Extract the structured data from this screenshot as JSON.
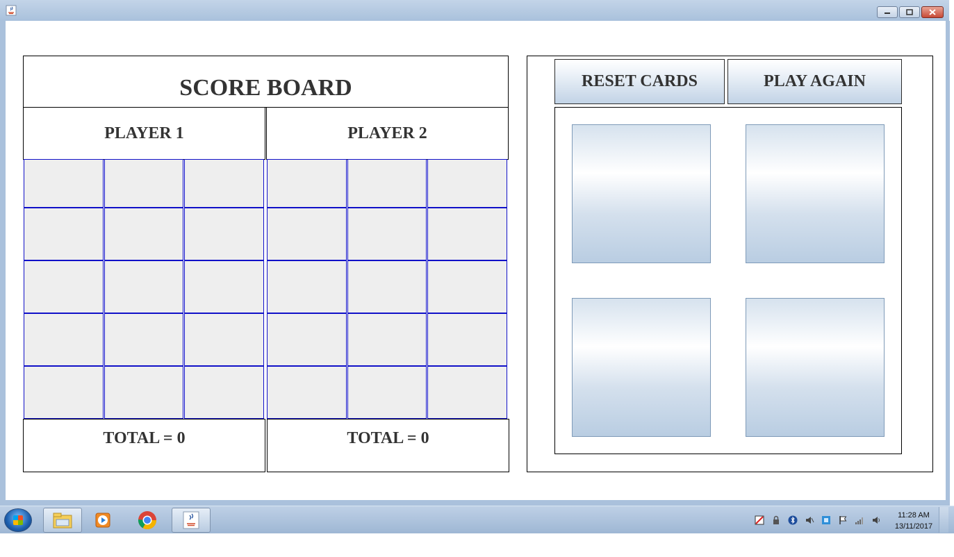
{
  "window": {
    "title": ""
  },
  "scoreboard": {
    "title": "SCORE BOARD",
    "player1": {
      "label": "PLAYER 1",
      "total_text": "TOTAL = 0"
    },
    "player2": {
      "label": "PLAYER 2",
      "total_text": "TOTAL = 0"
    }
  },
  "controls": {
    "reset_label": "RESET CARDS",
    "play_again_label": "PLAY AGAIN"
  },
  "taskbar": {
    "time": "11:28 AM",
    "date": "13/11/2017"
  },
  "colors": {
    "cell_bg": "#eeeeee",
    "cell_border": "#1010c8",
    "titlebar": "#aac1dc"
  }
}
